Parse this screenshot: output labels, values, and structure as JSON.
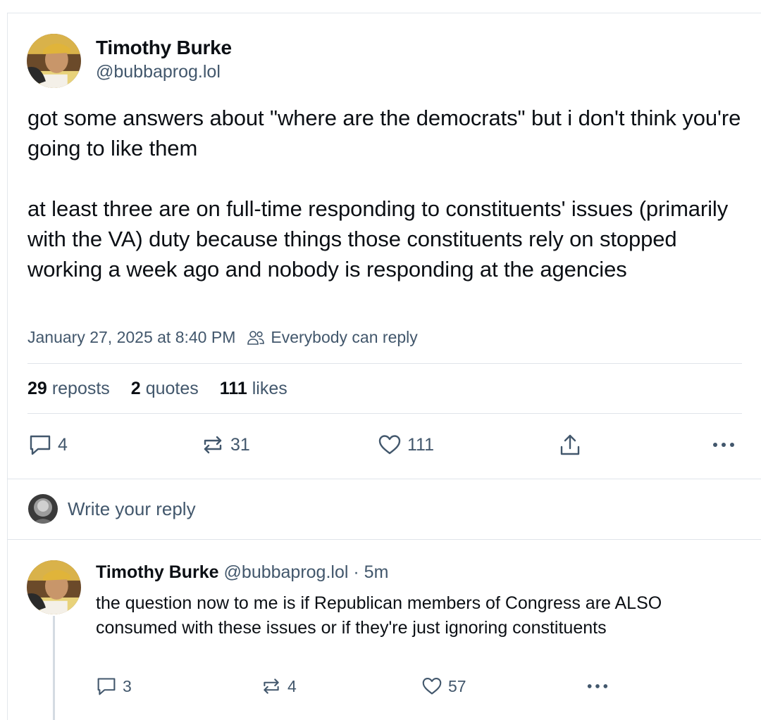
{
  "post": {
    "author_name": "Timothy Burke",
    "author_handle": "@bubbaprog.lol",
    "paragraphs": [
      "got some answers about \"where are the democrats\" but i don't think you're going to like them",
      "at least three are on full-time responding to constituents' issues (primarily with the VA) duty because things those constituents rely on stopped working a week ago and nobody is responding at the agencies"
    ],
    "timestamp": "January 27, 2025 at 8:40 PM",
    "reply_setting": "Everybody can reply",
    "stats": {
      "reposts_count": "29",
      "reposts_label": "reposts",
      "quotes_count": "2",
      "quotes_label": "quotes",
      "likes_count": "111",
      "likes_label": "likes"
    },
    "actions": {
      "reply_count": "4",
      "repost_count": "31",
      "like_count": "111"
    }
  },
  "composer": {
    "placeholder": "Write your reply"
  },
  "reply": {
    "author_name": "Timothy Burke",
    "author_handle": "@bubbaprog.lol",
    "time_ago": "· 5m",
    "text": "the question now to me is if Republican members of Congress are ALSO consumed with these issues or if they're just ignoring constituents",
    "actions": {
      "reply_count": "3",
      "repost_count": "4",
      "like_count": "57"
    }
  },
  "icons": {
    "reply": "speech-bubble-icon",
    "repost": "repost-arrows-icon",
    "like": "heart-icon",
    "share": "share-upload-icon",
    "more": "more-dots-icon",
    "reply_setting": "people-icon"
  },
  "colors": {
    "text": "#0b0f14",
    "secondary": "#42576c",
    "divider": "#dfe4ea"
  }
}
